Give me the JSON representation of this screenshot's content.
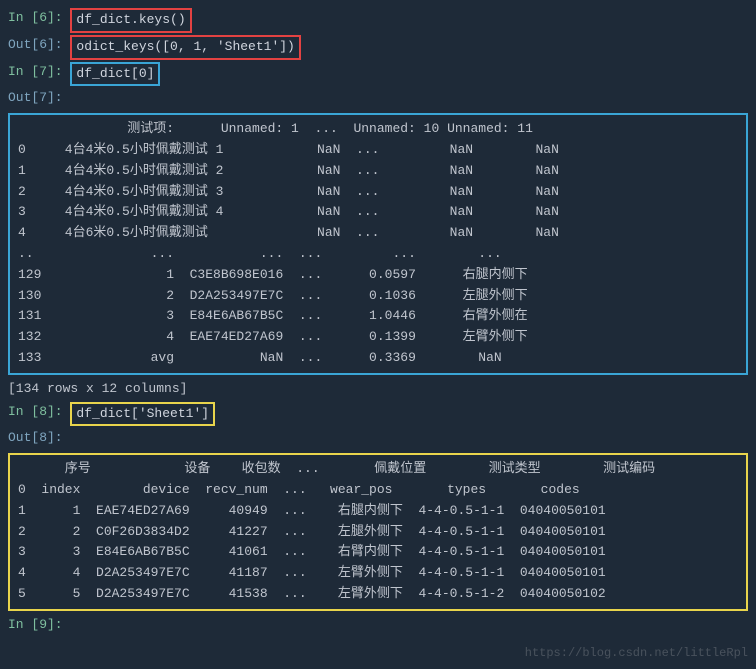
{
  "cells": {
    "in6": {
      "prompt": "In [6]: ",
      "code": "df_dict.keys()"
    },
    "out6": {
      "prompt": "Out[6]: ",
      "code": "odict_keys([0, 1, 'Sheet1'])"
    },
    "in7": {
      "prompt": "In [7]: ",
      "code": "df_dict[0]"
    },
    "out7": {
      "prompt": "Out[7]:"
    },
    "df0_header": "              测试项:      Unnamed: 1  ...  Unnamed: 10 Unnamed: 11",
    "df0_rows": [
      "0     4台4米0.5小时佩戴测试 1            NaN  ...         NaN        NaN",
      "1     4台4米0.5小时佩戴测试 2            NaN  ...         NaN        NaN",
      "2     4台4米0.5小时佩戴测试 3            NaN  ...         NaN        NaN",
      "3     4台4米0.5小时佩戴测试 4            NaN  ...         NaN        NaN",
      "4     4台6米0.5小时佩戴测试              NaN  ...         NaN        NaN",
      "..               ...           ...  ...         ...        ...",
      "129                1  C3E8B698E016  ...      0.0597      右腿内侧下",
      "130                2  D2A253497E7C  ...      0.1036      左腿外侧下",
      "131                3  E84E6AB67B5C  ...      1.0446      右臂外侧在",
      "132                4  EAE74ED27A69  ...      0.1399      左臂外侧下",
      "133              avg           NaN  ...      0.3369        NaN"
    ],
    "df0_shape": "[134 rows x 12 columns]",
    "in8": {
      "prompt": "In [8]: ",
      "code": "df_dict['Sheet1']"
    },
    "out8": {
      "prompt": "Out[8]:"
    },
    "df1_header": "      序号            设备    收包数  ...       佩戴位置        测试类型        测试编码",
    "df1_rows": [
      "0  index        device  recv_num  ...   wear_pos       types       codes",
      "1      1  EAE74ED27A69     40949  ...    右腿内侧下  4-4-0.5-1-1  04040050101",
      "2      2  C0F26D3834D2     41227  ...    左腿外侧下  4-4-0.5-1-1  04040050101",
      "3      3  E84E6AB67B5C     41061  ...    右臂内侧下  4-4-0.5-1-1  04040050101",
      "4      4  D2A253497E7C     41187  ...    左臂外侧下  4-4-0.5-1-1  04040050101",
      "5      5  D2A253497E7C     41538  ...    左臂外侧下  4-4-0.5-1-2  04040050102"
    ],
    "in9": {
      "prompt": "In [9]:"
    }
  },
  "watermark": "https://blog.csdn.net/littleRpl"
}
